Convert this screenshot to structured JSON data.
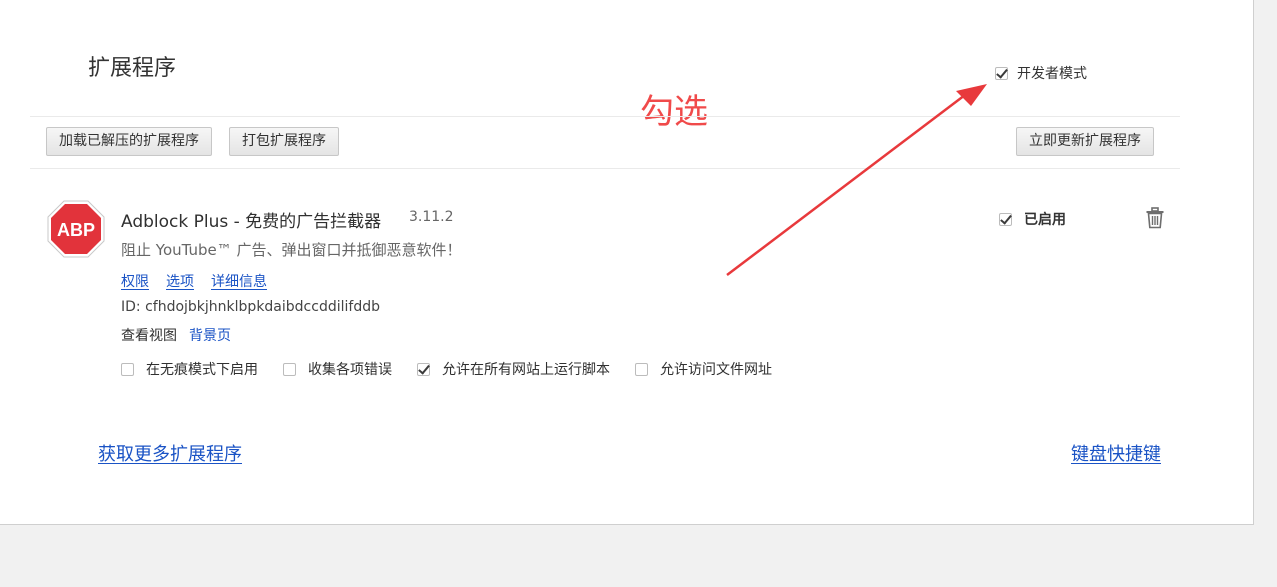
{
  "page": {
    "title": "扩展程序",
    "developer_mode": {
      "label": "开发者模式",
      "checked": true
    }
  },
  "annotation": {
    "text": "勾选",
    "color": "#f04a4a"
  },
  "toolbar": {
    "load_unpacked": "加载已解压的扩展程序",
    "pack_extension": "打包扩展程序",
    "update_now": "立即更新扩展程序"
  },
  "extension": {
    "icon_text": "ABP",
    "name": "Adblock Plus - 免费的广告拦截器",
    "version": "3.11.2",
    "description": "阻止 YouTube™ 广告、弹出窗口并抵御恶意软件！",
    "links": [
      "权限",
      "选项",
      "详细信息"
    ],
    "id_text": "ID: cfhdojbkjhnklbpkdaibdccddilifddb",
    "views_label": "查看视图",
    "views_link": "背景页",
    "enabled_label": "已启用",
    "options": [
      {
        "label": "在无痕模式下启用",
        "checked": false
      },
      {
        "label": "收集各项错误",
        "checked": false
      },
      {
        "label": "允许在所有网站上运行脚本",
        "checked": true
      },
      {
        "label": "允许访问文件网址",
        "checked": false
      }
    ]
  },
  "footer": {
    "more_extensions": "获取更多扩展程序",
    "keyboard_shortcuts": "键盘快捷键"
  },
  "colors": {
    "link": "#1a53c5",
    "abp_red": "#e2333b"
  }
}
